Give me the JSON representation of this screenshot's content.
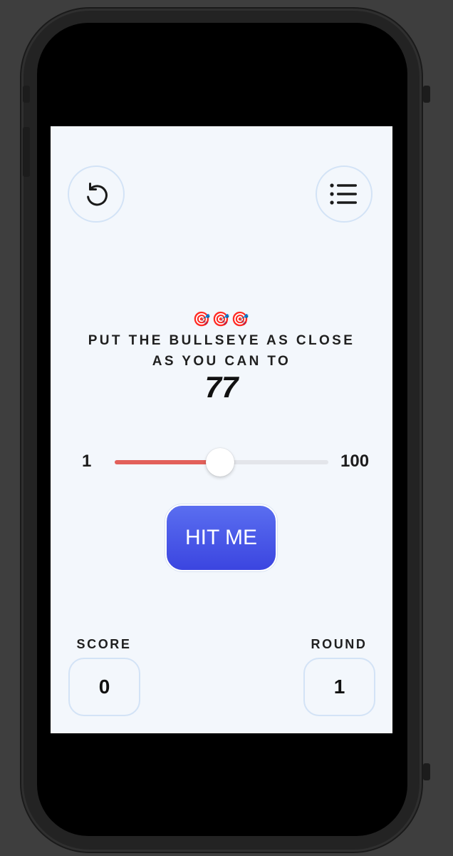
{
  "game": {
    "target_emojis": "🎯🎯🎯",
    "instruction_line1": "PUT THE BULLSEYE AS CLOSE",
    "instruction_line2": "AS YOU CAN TO",
    "target_value": "77"
  },
  "slider": {
    "min_label": "1",
    "max_label": "100",
    "min": 1,
    "max": 100,
    "value": 50
  },
  "hit_button": {
    "label": "HIT ME"
  },
  "stats": {
    "score_label": "SCORE",
    "score_value": "0",
    "round_label": "ROUND",
    "round_value": "1"
  },
  "colors": {
    "background": "#f3f7fc",
    "slider_fill": "#e2605a",
    "button_gradient_top": "#5a6ef0",
    "button_gradient_bottom": "#3b45e0",
    "ring_border": "#d3e3f6"
  },
  "icons": {
    "restart": "restart-icon",
    "leaderboard": "list-icon"
  }
}
